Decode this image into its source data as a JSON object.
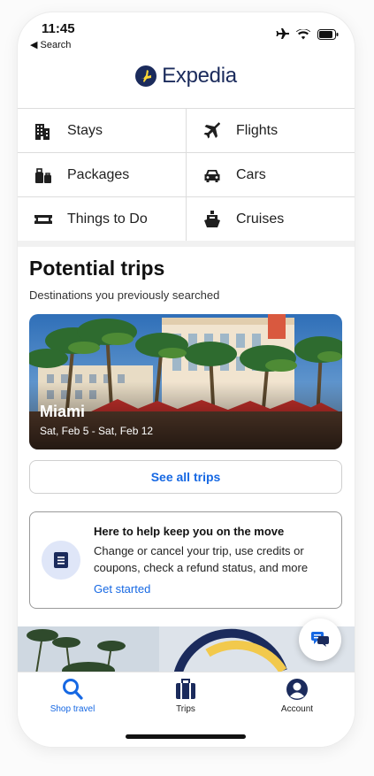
{
  "status_bar": {
    "time": "11:45",
    "back_label": "◀ Search"
  },
  "brand": {
    "name": "Expedia",
    "color": "#1b2b5c"
  },
  "categories": [
    {
      "label": "Stays",
      "icon": "building-icon"
    },
    {
      "label": "Flights",
      "icon": "plane-icon"
    },
    {
      "label": "Packages",
      "icon": "luggage-icon"
    },
    {
      "label": "Cars",
      "icon": "car-icon"
    },
    {
      "label": "Things to Do",
      "icon": "ticket-icon"
    },
    {
      "label": "Cruises",
      "icon": "ship-icon"
    }
  ],
  "trips": {
    "title": "Potential trips",
    "subtitle": "Destinations you previously searched",
    "card": {
      "destination": "Miami",
      "dates": "Sat, Feb 5 - Sat, Feb 12"
    },
    "see_all_label": "See all trips"
  },
  "help": {
    "title": "Here to help keep you on the move",
    "text": "Change or cancel your trip, use credits or coupons, check a refund status, and more",
    "link": "Get started"
  },
  "tabs": [
    {
      "label": "Shop travel",
      "icon": "search-icon",
      "active": true
    },
    {
      "label": "Trips",
      "icon": "suitcase-icon",
      "active": false
    },
    {
      "label": "Account",
      "icon": "account-icon",
      "active": false
    }
  ],
  "colors": {
    "accent": "#1668e3",
    "help_icon_bg": "#dfe6f8",
    "logo_yellow": "#fdd835"
  }
}
